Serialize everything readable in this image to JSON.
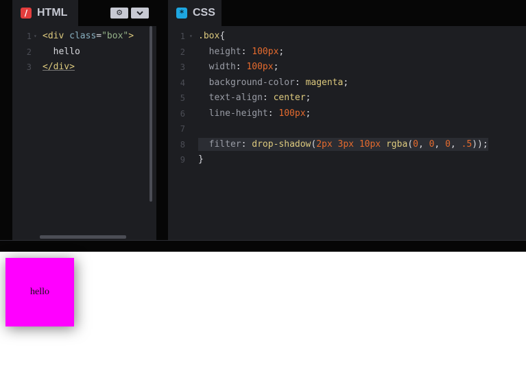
{
  "html_pane": {
    "tab_title": "HTML",
    "tab_icon": "html-icon",
    "tools": [
      "gear-icon",
      "chevron-down-icon"
    ],
    "lines": [
      {
        "n": "1",
        "tokens": [
          [
            "<",
            "c-tag"
          ],
          [
            "div",
            "c-tag"
          ],
          [
            " class",
            "c-attr"
          ],
          [
            "=",
            "c-punc"
          ],
          [
            "\"box\"",
            "c-str"
          ],
          [
            ">",
            "c-tag"
          ]
        ]
      },
      {
        "n": "2",
        "tokens": [
          [
            "  hello",
            "c-punc"
          ]
        ]
      },
      {
        "n": "3",
        "tokens": [
          [
            "</div>",
            "c-tag c-ul"
          ]
        ]
      }
    ]
  },
  "css_pane": {
    "tab_title": "CSS",
    "tab_icon": "css-icon",
    "lines": [
      {
        "n": "1",
        "tokens": [
          [
            ".box",
            "c-sel"
          ],
          [
            "{",
            "c-punc"
          ]
        ]
      },
      {
        "n": "2",
        "tokens": [
          [
            "  height",
            "c-prop"
          ],
          [
            ": ",
            "c-punc"
          ],
          [
            "100px",
            "c-num"
          ],
          [
            ";",
            "c-punc"
          ]
        ]
      },
      {
        "n": "3",
        "tokens": [
          [
            "  width",
            "c-prop"
          ],
          [
            ": ",
            "c-punc"
          ],
          [
            "100px",
            "c-num"
          ],
          [
            ";",
            "c-punc"
          ]
        ]
      },
      {
        "n": "4",
        "tokens": [
          [
            "  background-color",
            "c-prop"
          ],
          [
            ": ",
            "c-punc"
          ],
          [
            "magenta",
            "c-val"
          ],
          [
            ";",
            "c-punc"
          ]
        ]
      },
      {
        "n": "5",
        "tokens": [
          [
            "  text-align",
            "c-prop"
          ],
          [
            ": ",
            "c-punc"
          ],
          [
            "center",
            "c-val"
          ],
          [
            ";",
            "c-punc"
          ]
        ]
      },
      {
        "n": "6",
        "tokens": [
          [
            "  line-height",
            "c-prop"
          ],
          [
            ": ",
            "c-punc"
          ],
          [
            "100px",
            "c-num"
          ],
          [
            ";",
            "c-punc"
          ]
        ]
      },
      {
        "n": "7",
        "tokens": []
      },
      {
        "n": "8",
        "highlight": true,
        "tokens": [
          [
            "  ",
            "c-punc"
          ],
          [
            "filter",
            "c-prop"
          ],
          [
            ": ",
            "c-punc"
          ],
          [
            "drop-shadow",
            "c-val"
          ],
          [
            "(",
            "c-punc"
          ],
          [
            "2px",
            "c-num"
          ],
          [
            " ",
            "c-punc"
          ],
          [
            "3px",
            "c-num"
          ],
          [
            " ",
            "c-punc"
          ],
          [
            "10px",
            "c-num"
          ],
          [
            " ",
            "c-punc"
          ],
          [
            "rgba",
            "c-val"
          ],
          [
            "(",
            "c-punc"
          ],
          [
            "0",
            "c-num"
          ],
          [
            ", ",
            "c-punc"
          ],
          [
            "0",
            "c-num"
          ],
          [
            ", ",
            "c-punc"
          ],
          [
            "0",
            "c-num"
          ],
          [
            ", ",
            "c-punc"
          ],
          [
            ".5",
            "c-num"
          ],
          [
            "));",
            "c-punc"
          ]
        ]
      },
      {
        "n": "9",
        "tokens": [
          [
            "}",
            "c-punc"
          ]
        ]
      }
    ]
  },
  "preview": {
    "box_text": "hello",
    "box_color": "#ff00ff"
  }
}
